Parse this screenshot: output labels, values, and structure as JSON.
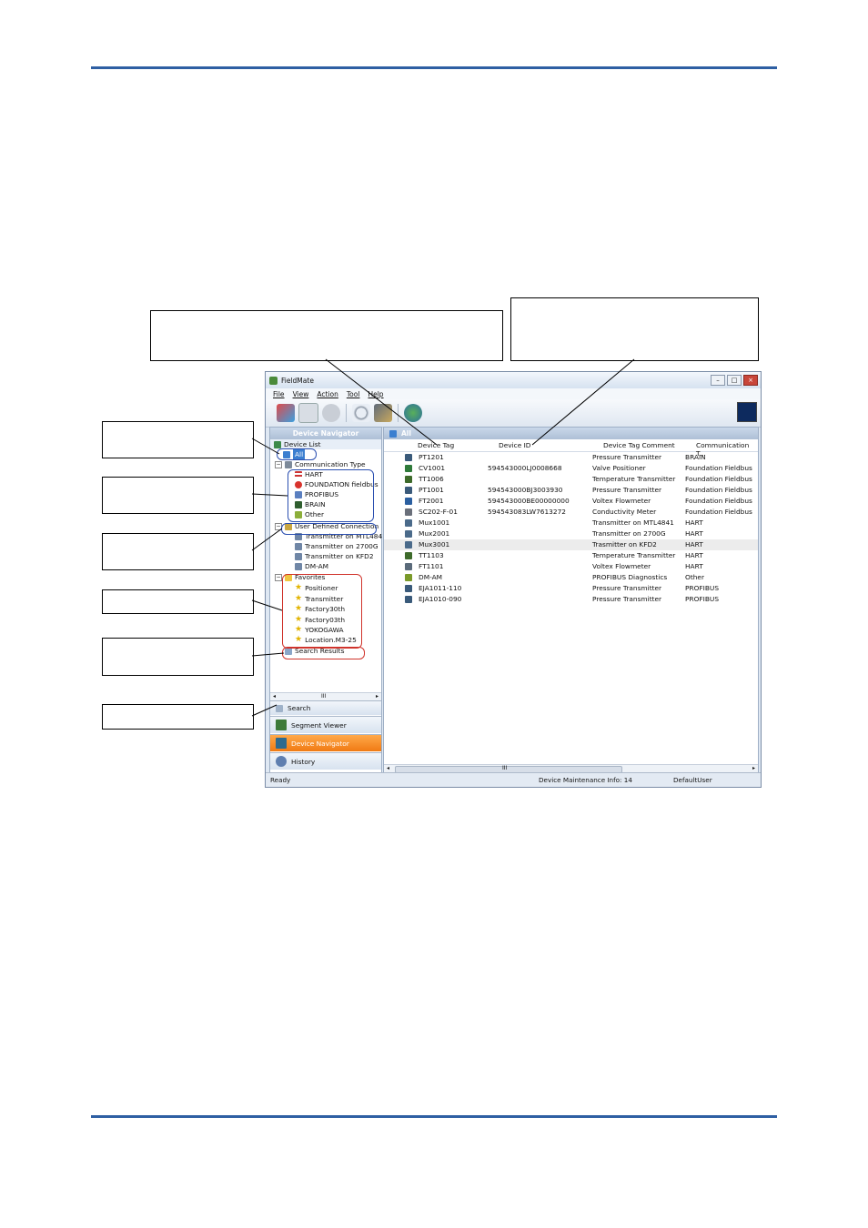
{
  "window": {
    "title": "FieldMate"
  },
  "menu": [
    "File",
    "View",
    "Action",
    "Tool",
    "Help"
  ],
  "left_panel": {
    "header": "Device Navigator",
    "device_list_label": "Device List",
    "tree": {
      "all": "All",
      "communication_type": "Communication Type",
      "comm_items": [
        "HART",
        "FOUNDATION fieldbus",
        "PROFIBUS",
        "BRAIN",
        "Other"
      ],
      "user_defined": "User Defined Connection",
      "user_items": [
        "Transmitter on MTL4841",
        "Transmitter on 2700G",
        "Transmitter on KFD2",
        "DM-AM"
      ],
      "favorites": "Favorites",
      "fav_items": [
        "Positioner",
        "Transmitter",
        "Factory30th",
        "Factory03th",
        "YOKOGAWA",
        "Location.M3-25"
      ],
      "search_results": "Search Results"
    },
    "scroll_mark": "III",
    "nav_buttons": [
      "Search",
      "Segment Viewer",
      "Device Navigator",
      "History"
    ]
  },
  "right_panel": {
    "header": "All",
    "columns": [
      "Device Tag",
      "Device ID",
      "Device Tag Comment",
      "Communication T..."
    ],
    "rows": [
      {
        "tag": "PT1201",
        "id": "",
        "comment": "Pressure Transmitter",
        "comm": "BRAIN"
      },
      {
        "tag": "CV1001",
        "id": "594543000LJ0008668",
        "comment": "Valve Positioner",
        "comm": "Foundation Fieldbus"
      },
      {
        "tag": "TT1006",
        "id": "",
        "comment": "Temperature Transmitter",
        "comm": "Foundation Fieldbus"
      },
      {
        "tag": "PT1001",
        "id": "594543000BJ3003930",
        "comment": "Pressure Transmitter",
        "comm": "Foundation Fieldbus"
      },
      {
        "tag": "FT2001",
        "id": "594543000BE00000000",
        "comment": "Voltex Flowmeter",
        "comm": "Foundation Fieldbus"
      },
      {
        "tag": "SC202-F-01",
        "id": "594543083LW7613272",
        "comment": "Conductivity Meter",
        "comm": "Foundation Fieldbus"
      },
      {
        "tag": "Mux1001",
        "id": "",
        "comment": "Transmitter on MTL4841",
        "comm": "HART"
      },
      {
        "tag": "Mux2001",
        "id": "",
        "comment": "Transmitter on 2700G",
        "comm": "HART"
      },
      {
        "tag": "Mux3001",
        "id": "",
        "comment": "Trasmitter on KFD2",
        "comm": "HART"
      },
      {
        "tag": "TT1103",
        "id": "",
        "comment": "Temperature Transmitter",
        "comm": "HART"
      },
      {
        "tag": "FT1101",
        "id": "",
        "comment": "Voltex Flowmeter",
        "comm": "HART"
      },
      {
        "tag": "DM-AM",
        "id": "",
        "comment": "PROFIBUS Diagnostics",
        "comm": "Other"
      },
      {
        "tag": "EJA1011-110",
        "id": "",
        "comment": "Pressure Transmitter",
        "comm": "PROFIBUS"
      },
      {
        "tag": "EJA1010-090",
        "id": "",
        "comment": "Pressure Transmitter",
        "comm": "PROFIBUS"
      }
    ],
    "scroll_mark": "III"
  },
  "status_bar": {
    "left": "Ready",
    "middle": "Device Maintenance Info: 14",
    "right": "DefaultUser"
  }
}
